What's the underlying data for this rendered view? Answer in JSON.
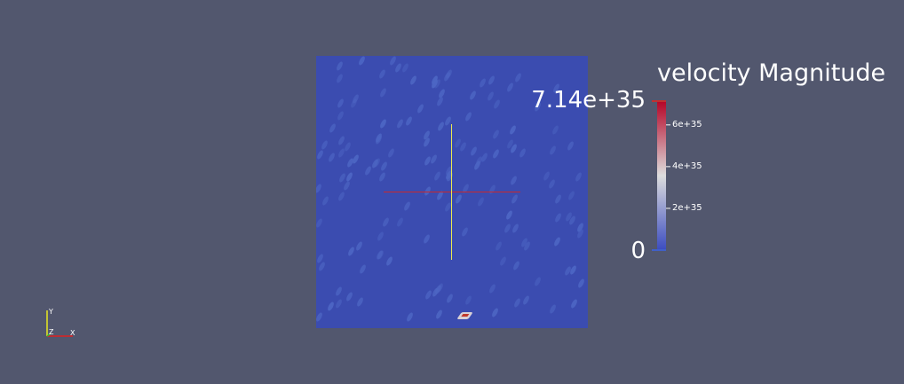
{
  "colors": {
    "background": "#52576e",
    "field": "#3b4cb0",
    "probe_x": "#c8282d",
    "probe_y": "#eaea50",
    "colormap_low": "#3b4cc0",
    "colormap_mid": "#dddddd",
    "colormap_high": "#b40426"
  },
  "legend": {
    "title": "velocity Magnitude",
    "max_label": "7.14e+35",
    "min_label": "0",
    "ticks": [
      "6e+35",
      "4e+35",
      "2e+35"
    ],
    "tick_values": [
      6e+35,
      4e+35,
      2e+35
    ],
    "range": [
      0,
      7.14e+35
    ]
  },
  "orientation": {
    "x_label": "X",
    "y_label": "Y",
    "z_label": "Z",
    "x_color": "#e02020",
    "y_color": "#e8e820",
    "z_color": "#30c030",
    "icon": "orientation-axes-icon"
  }
}
